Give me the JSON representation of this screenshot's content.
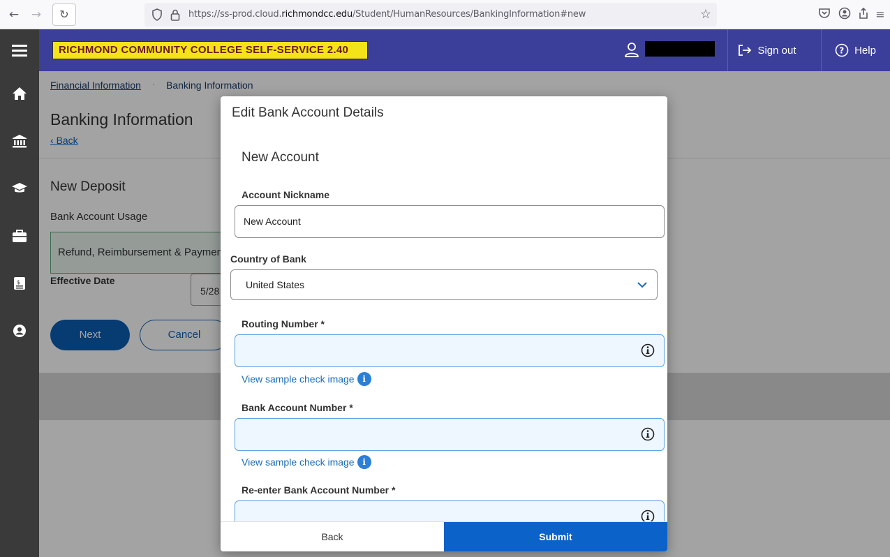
{
  "browser": {
    "url_prefix": "https://ss-prod.cloud.",
    "url_domain": "richmondcc.edu",
    "url_path": "/Student/HumanResources/BankingInformation#new"
  },
  "header": {
    "logo_text": "RICHMOND COMMUNITY COLLEGE  SELF-SERVICE 2.40",
    "signout_label": "Sign out",
    "help_label": "Help"
  },
  "breadcrumb": {
    "parent": "Financial Information",
    "separator": "·",
    "current": "Banking Information"
  },
  "page": {
    "title": "Banking Information",
    "back_label": "Back",
    "deposit_title": "New Deposit",
    "usage_label": "Bank Account Usage",
    "usage_value": "Refund, Reimbursement & Payments",
    "effective_label": "Effective Date",
    "effective_value": "5/28",
    "next_label": "Next",
    "cancel_label": "Cancel"
  },
  "modal": {
    "title": "Edit Bank Account Details",
    "section_title": "New Account",
    "nickname_label": "Account Nickname",
    "nickname_value": "New Account",
    "country_label": "Country of Bank",
    "country_value": "United States",
    "routing_label": "Routing Number *",
    "routing_value": "",
    "sample_link_1": "View sample check image",
    "account_label": "Bank Account Number *",
    "account_value": "",
    "sample_link_2": "View sample check image",
    "reenter_label": "Re-enter Bank Account Number *",
    "reenter_value": "",
    "back_button": "Back",
    "submit_button": "Submit"
  },
  "colors": {
    "header_bg": "#3c3f9a",
    "logo_bg": "#f5e31a",
    "primary_button": "#0b63c9",
    "rail_bg": "#3a3a3a"
  },
  "icons": {
    "rail": [
      "menu-icon",
      "home-icon",
      "bank-icon",
      "graduation-cap-icon",
      "briefcase-icon",
      "document-icon",
      "user-circle-icon"
    ]
  }
}
